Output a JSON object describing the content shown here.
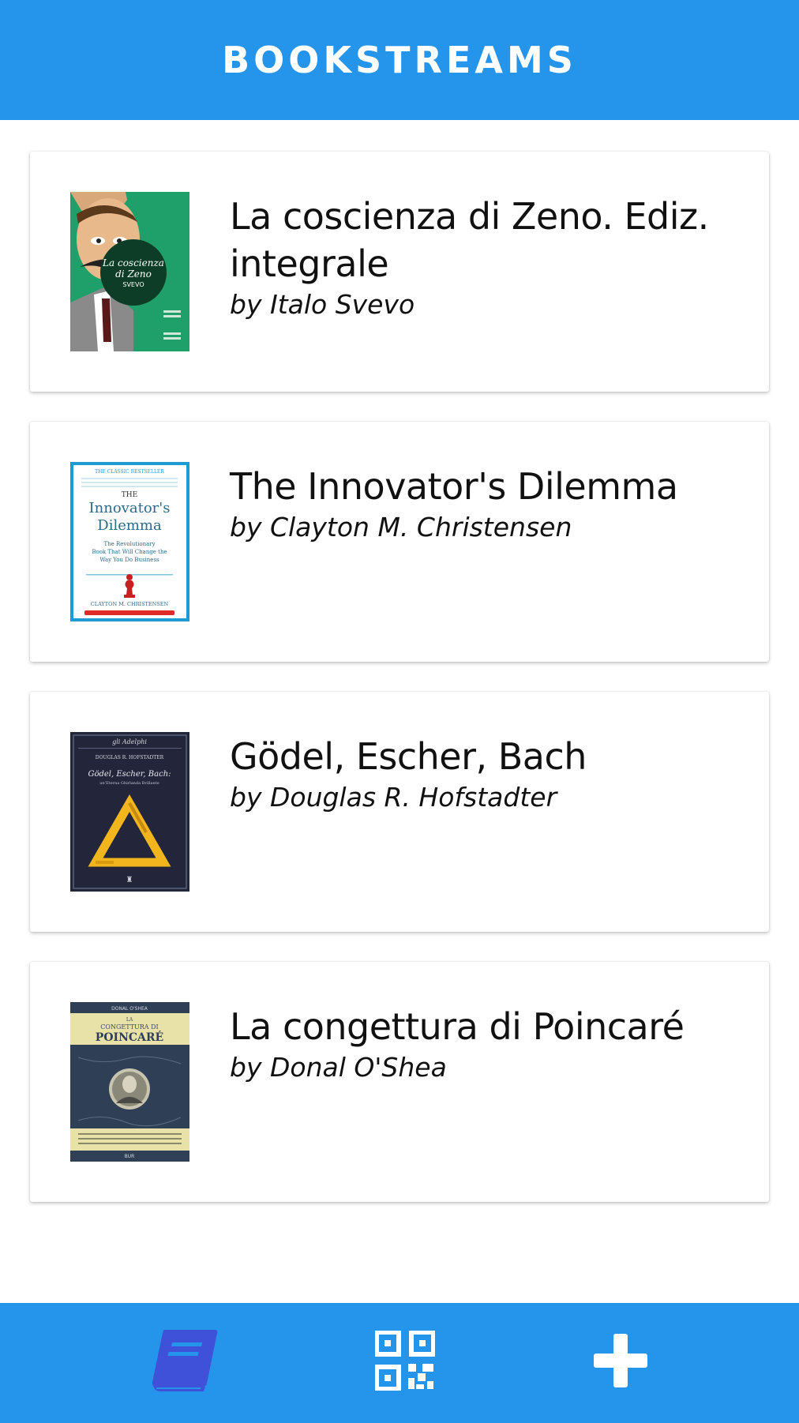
{
  "header": {
    "title": "BOOKSTREAMS"
  },
  "books": [
    {
      "title_line1": "La coscienza di Zeno. Ediz.",
      "title_line2": "integrale",
      "author": "by Italo Svevo",
      "cover": {
        "title": "La coscienza",
        "title2": "di Zeno",
        "author": "SVEVO"
      }
    },
    {
      "title_line1": "The Innovator's Dilemma",
      "title_line2": "",
      "author": "by Clayton M. Christensen",
      "cover": {
        "top": "THE CLASSIC BESTSELLER",
        "the": "THE",
        "title1": "Innovator's",
        "title2": "Dilemma",
        "sub1": "The Revolutionary",
        "sub2": "Book That Will Change the",
        "sub3": "Way You Do Business",
        "author": "CLAYTON M. CHRISTENSEN"
      }
    },
    {
      "title_line1": "Gödel, Escher, Bach",
      "title_line2": "",
      "author": "by Douglas R. Hofstadter",
      "cover": {
        "publisher": "gli Adelphi",
        "author": "DOUGLAS R. HOFSTADTER",
        "title": "Gödel, Escher, Bach:",
        "sub": "un'Eterna Ghirlanda Brillante"
      }
    },
    {
      "title_line1": "La congettura di Poincaré",
      "title_line2": "",
      "author": "by Donal O'Shea",
      "cover": {
        "author": "DONAL O'SHEA",
        "la": "LA",
        "title1": "CONGETTURA DI",
        "title2": "POINCARÉ",
        "publisher": "BUR"
      }
    }
  ],
  "bottom_nav": {
    "items": [
      {
        "icon": "book-icon",
        "active": true
      },
      {
        "icon": "qr-code-icon",
        "active": false
      },
      {
        "icon": "plus-icon",
        "active": false
      }
    ]
  },
  "colors": {
    "primary": "#2595EC",
    "active_icon": "#3F51D8",
    "icon": "#ffffff"
  }
}
